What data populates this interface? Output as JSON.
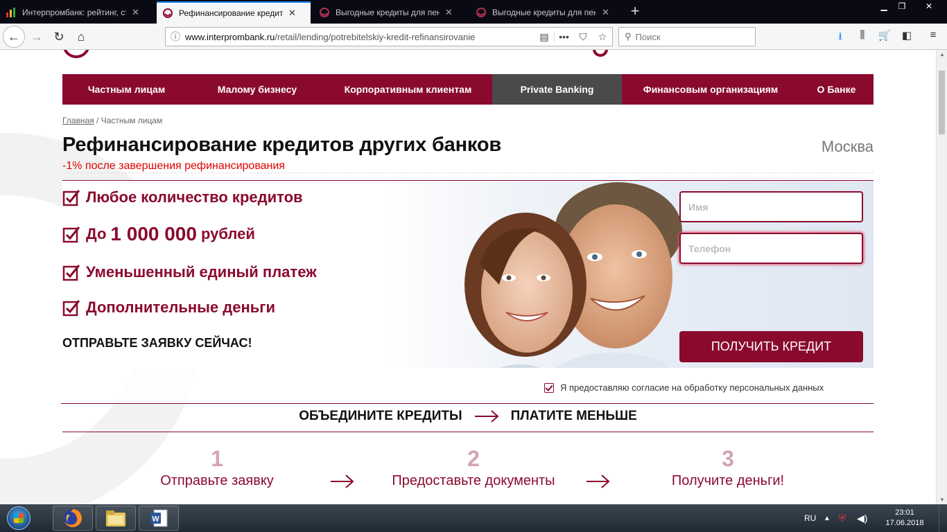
{
  "browser": {
    "tabs": [
      {
        "title": "Интерпромбанк: рейтинг, ставки",
        "active": false
      },
      {
        "title": "Рефинансирование кредита - Интерпромбанк",
        "active": true
      },
      {
        "title": "Выгодные кредиты для пенсионеров",
        "active": false
      },
      {
        "title": "Выгодные кредиты для пенсионеров",
        "active": false
      }
    ],
    "url_host": "www.interprombank.ru",
    "url_path": "/retail/lending/potrebitelskiy-kredit-refinansirovanie",
    "search_placeholder": "Поиск",
    "accent": "#0a84ff"
  },
  "nav": {
    "items": [
      {
        "label": "Частным лицам",
        "active": false
      },
      {
        "label": "Малому бизнесу",
        "active": false
      },
      {
        "label": "Корпоративным клиентам",
        "active": false
      },
      {
        "label": "Private Banking",
        "active": true
      },
      {
        "label": "Финансовым организациям",
        "active": false
      },
      {
        "label": "О Банке",
        "active": false
      }
    ],
    "color": "#8a0a2e"
  },
  "breadcrumb": {
    "home": "Главная",
    "separator": " / ",
    "current": "Частным лицам"
  },
  "header": {
    "title": "Рефинансирование кредитов других банков",
    "subtitle": "-1% после завершения рефинансирования",
    "city": "Москва"
  },
  "features": {
    "f1": "Любое количество кредитов",
    "f2_prefix": "До",
    "f2_amount": "1 000 000",
    "f2_suffix": "рублей",
    "f3": "Уменьшенный единый платеж",
    "f4": "Дополнительные деньги",
    "call_to_action": "ОТПРАВЬТЕ ЗАЯВКУ СЕЙЧАС!"
  },
  "form": {
    "name_placeholder": "Имя",
    "phone_placeholder": "Телефон",
    "submit_label": "ПОЛУЧИТЬ КРЕДИТ",
    "consent_label": "Я предоставляю согласие на обработку персональных данных",
    "consent_checked": true
  },
  "slogan": {
    "left": "ОБЪЕДИНИТЕ КРЕДИТЫ",
    "right": "ПЛАТИТЕ МЕНЬШЕ"
  },
  "steps": [
    {
      "num": "1",
      "label": "Отправьте заявку"
    },
    {
      "num": "2",
      "label": "Предоставьте документы"
    },
    {
      "num": "3",
      "label": "Получите деньги!"
    }
  ],
  "taskbar": {
    "language": "RU",
    "time": "23:01",
    "date": "17.06.2018",
    "pinned": [
      "firefox-icon",
      "explorer-icon",
      "word-icon"
    ]
  }
}
